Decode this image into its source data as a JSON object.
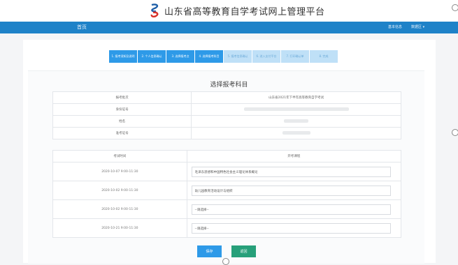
{
  "header": {
    "site_title": "山东省高等教育自学考试网上管理平台"
  },
  "navbar": {
    "home": "首页",
    "right_link_1": "基本信息",
    "right_link_2": "数据区",
    "right_caret": "▾"
  },
  "steps": [
    {
      "label": "1. 报考须知及说明",
      "state": "active"
    },
    {
      "label": "2. 个人信息确认",
      "state": "active"
    },
    {
      "label": "3. 选择报考点",
      "state": "active"
    },
    {
      "label": "4. 选择报考科目",
      "state": "active"
    },
    {
      "label": "5. 报考信息确认",
      "state": "todo"
    },
    {
      "label": "6. 进入支付平台",
      "state": "todo"
    },
    {
      "label": "7. 打印确认单",
      "state": "todo"
    },
    {
      "label": "8. 完成",
      "state": "todo"
    }
  ],
  "page_title": "选择报考科目",
  "info": {
    "rows": [
      {
        "label": "报考批次",
        "value": "山东省2021年下半年高等教育自学考试"
      },
      {
        "label": "身份证号",
        "value": ""
      },
      {
        "label": "姓名",
        "value": ""
      },
      {
        "label": "准考证号",
        "value": ""
      }
    ]
  },
  "exam_table": {
    "col_time": "考试时间",
    "col_course": "开考课程",
    "rows": [
      {
        "time": "2020-10-07 9:00-11:30",
        "course": "毛泽东思想和中国特色社会主义理论体系概论"
      },
      {
        "time": "2020-10-02 9:00-11:30",
        "course": "幼儿园教育活动设计与组织"
      },
      {
        "time": "2020-10-02 9:00-11:30",
        "course": "--请选择--"
      },
      {
        "time": "2020-10-21 9:00-11:30",
        "course": "--请选择--"
      }
    ]
  },
  "buttons": {
    "save": "保存",
    "back": "返回"
  },
  "colors": {
    "nav": "#1e82c8",
    "primary": "#2e9ae8",
    "success": "#27a07a"
  }
}
